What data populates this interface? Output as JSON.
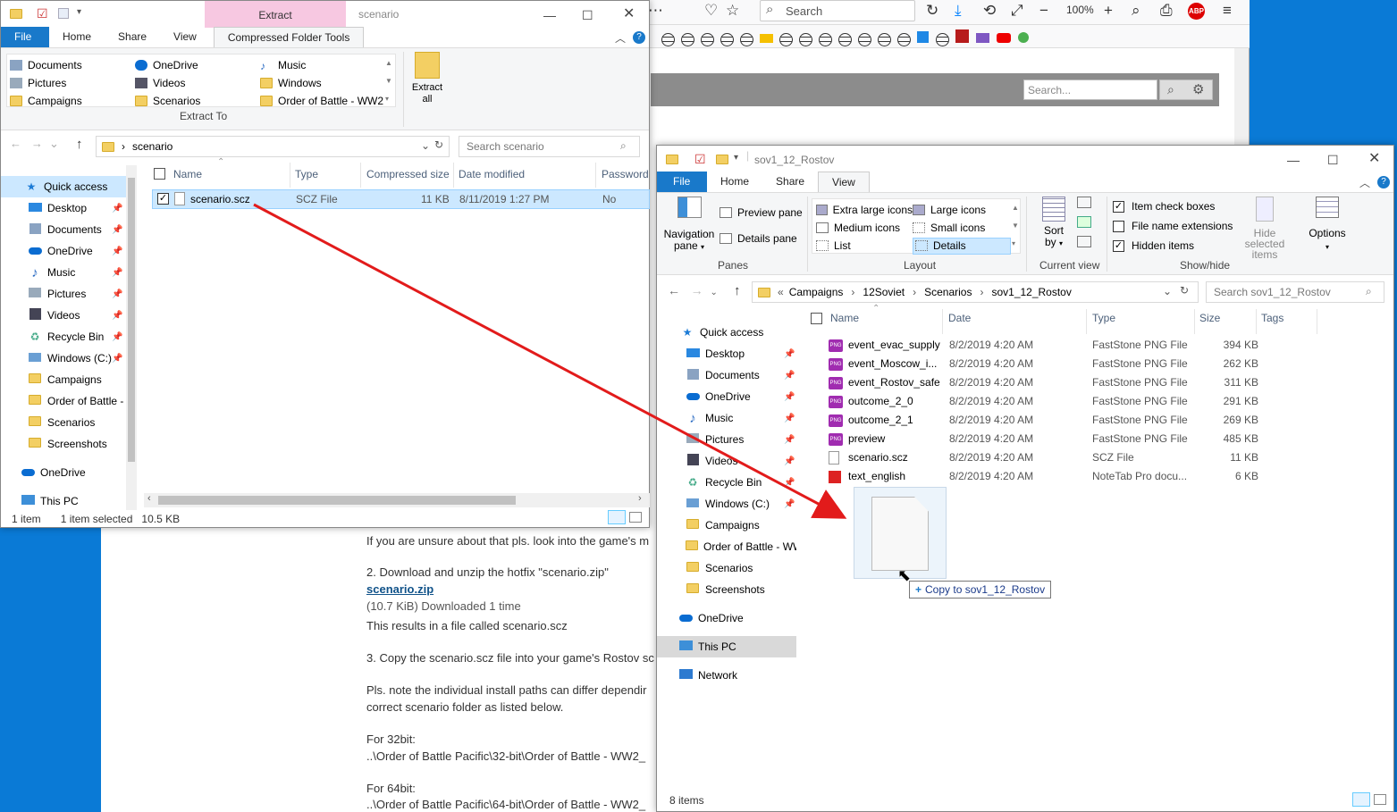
{
  "browser": {
    "search_placeholder": "Search",
    "zoom": "100%",
    "site_search_placeholder": "Search...",
    "article_lines": [
      "If you are unsure about that pls. look into the game's m",
      "2. Download and unzip the hotfix \"scenario.zip\"",
      "scenario.zip",
      "(10.7 KiB) Downloaded 1 time",
      "This results in a file called scenario.scz",
      "3. Copy the scenario.scz file into your game's Rostov sc",
      "Pls. note the individual install paths can differ dependir",
      "correct scenario folder as listed below.",
      "For 32bit:",
      "..\\Order of Battle Pacific\\32-bit\\Order of Battle - WW2_",
      "For 64bit:",
      "..\\Order of Battle Pacific\\64-bit\\Order of Battle - WW2_"
    ]
  },
  "left": {
    "title": "scenario",
    "extract_context_tab": "Extract",
    "tabs": {
      "file": "File",
      "home": "Home",
      "share": "Share",
      "view": "View",
      "tools": "Compressed Folder Tools"
    },
    "ribbon_dest": [
      [
        "Documents",
        "OneDrive",
        "Music"
      ],
      [
        "Pictures",
        "Videos",
        "Windows"
      ],
      [
        "Campaigns",
        "Scenarios",
        "Order of Battle - WW2"
      ]
    ],
    "extract_to": "Extract To",
    "extract_all": "Extract all",
    "address": "scenario",
    "search": "Search scenario",
    "nav": [
      "Quick access",
      "Desktop",
      "Documents",
      "OneDrive",
      "Music",
      "Pictures",
      "Videos",
      "Recycle Bin",
      "Windows (C:)",
      "Campaigns",
      "Order of Battle -",
      "Scenarios",
      "Screenshots",
      "OneDrive",
      "This PC"
    ],
    "columns": {
      "name": "Name",
      "type": "Type",
      "size": "Compressed size",
      "date": "Date modified",
      "pwd": "Password"
    },
    "file": {
      "name": "scenario.scz",
      "type": "SCZ File",
      "size": "11 KB",
      "date": "8/11/2019 1:27 PM",
      "pwd": "No"
    },
    "status": {
      "count": "1 item",
      "selected": "1 item selected",
      "size": "10.5 KB"
    }
  },
  "right": {
    "title": "sov1_12_Rostov",
    "tabs": {
      "file": "File",
      "home": "Home",
      "share": "Share",
      "view": "View"
    },
    "panes": {
      "nav": "Navigation",
      "nav2": "pane",
      "preview": "Preview pane",
      "details": "Details pane",
      "group": "Panes"
    },
    "layout": {
      "xl": "Extra large icons",
      "large": "Large icons",
      "medium": "Medium icons",
      "small": "Small icons",
      "list": "List",
      "details": "Details",
      "group": "Layout"
    },
    "view": {
      "sort": "Sort",
      "sort2": "by",
      "group": "Current view"
    },
    "showhide": {
      "checkboxes": "Item check boxes",
      "ext": "File name extensions",
      "hidden": "Hidden items",
      "hide_sel": "Hide selected",
      "hide_sel2": "items",
      "options": "Options",
      "group": "Show/hide"
    },
    "breadcrumb": [
      "Campaigns",
      "12Soviet",
      "Scenarios",
      "sov1_12_Rostov"
    ],
    "search": "Search sov1_12_Rostov",
    "nav": [
      "Quick access",
      "Desktop",
      "Documents",
      "OneDrive",
      "Music",
      "Pictures",
      "Videos",
      "Recycle Bin",
      "Windows (C:)",
      "Campaigns",
      "Order of Battle - WW",
      "Scenarios",
      "Screenshots",
      "OneDrive",
      "This PC",
      "Network"
    ],
    "columns": {
      "name": "Name",
      "date": "Date",
      "type": "Type",
      "size": "Size",
      "tags": "Tags"
    },
    "files": [
      {
        "name": "event_evac_supply",
        "date": "8/2/2019 4:20 AM",
        "type": "FastStone PNG File",
        "size": "394 KB",
        "icon": "png"
      },
      {
        "name": "event_Moscow_i...",
        "date": "8/2/2019 4:20 AM",
        "type": "FastStone PNG File",
        "size": "262 KB",
        "icon": "png"
      },
      {
        "name": "event_Rostov_safe",
        "date": "8/2/2019 4:20 AM",
        "type": "FastStone PNG File",
        "size": "311 KB",
        "icon": "png"
      },
      {
        "name": "outcome_2_0",
        "date": "8/2/2019 4:20 AM",
        "type": "FastStone PNG File",
        "size": "291 KB",
        "icon": "png"
      },
      {
        "name": "outcome_2_1",
        "date": "8/2/2019 4:20 AM",
        "type": "FastStone PNG File",
        "size": "269 KB",
        "icon": "png"
      },
      {
        "name": "preview",
        "date": "8/2/2019 4:20 AM",
        "type": "FastStone PNG File",
        "size": "485 KB",
        "icon": "png"
      },
      {
        "name": "scenario.scz",
        "date": "8/2/2019 4:20 AM",
        "type": "SCZ File",
        "size": "11 KB",
        "icon": "file"
      },
      {
        "name": "text_english",
        "date": "8/2/2019 4:20 AM",
        "type": "NoteTab Pro docu...",
        "size": "6 KB",
        "icon": "notetab"
      }
    ],
    "status": "8 items",
    "drag_tooltip": "Copy to sov1_12_Rostov"
  }
}
